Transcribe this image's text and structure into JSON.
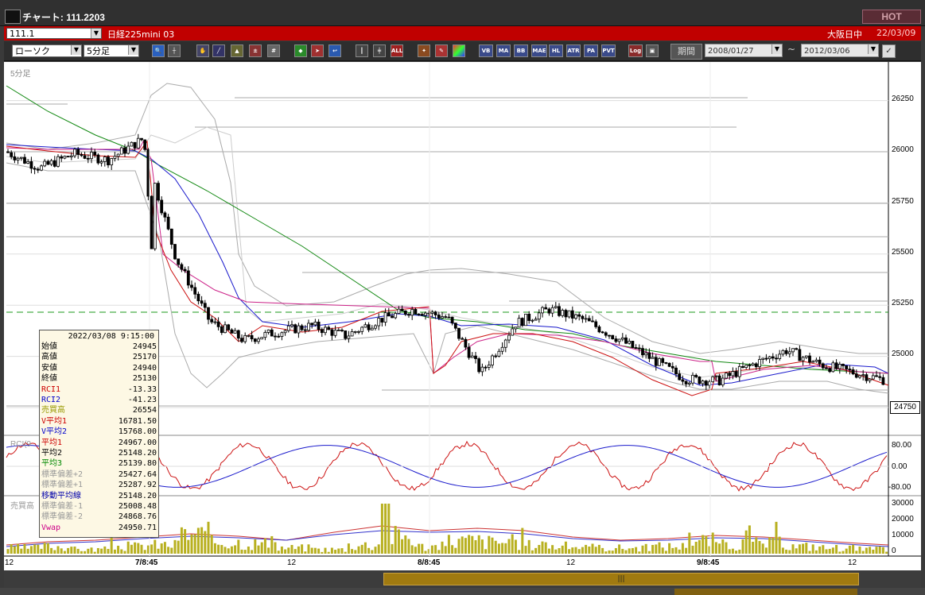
{
  "window": {
    "title": "チャート: 111.2203",
    "hot_label": "HOT"
  },
  "header": {
    "symbol": "111.1",
    "instrument": "日経225mini 03",
    "market": "大阪日中",
    "date": "22/03/09"
  },
  "toolbar": {
    "chart_type": "ローソク",
    "interval": "5分足",
    "icons": [
      "zoom-icon",
      "cursor-icon",
      "hand-icon",
      "line-icon",
      "shape-icon",
      "measure-icon",
      "grid-icon",
      "fill-icon",
      "pointer-icon",
      "arrow-icon",
      "candle-icon",
      "bar-icon",
      "all-icon",
      "wrench-icon",
      "palette-icon",
      "color-icon"
    ],
    "indicator_buttons": [
      "VB",
      "MA",
      "BB",
      "MAE",
      "HL",
      "ATR",
      "PA RA",
      "PVT",
      "Log"
    ],
    "period_label": "期間",
    "date_from": "2008/01/27",
    "date_sep": "~",
    "date_to": "2012/03/06"
  },
  "chart": {
    "panel_label": "5分足",
    "rci_label": "RCI(9",
    "volume_label": "売買高",
    "current_price_label": "24750",
    "price_ticks": [
      "26250",
      "26000",
      "25750",
      "25500",
      "25250",
      "25000"
    ],
    "rci_ticks": [
      "80.00",
      "0.00",
      "-80.00"
    ],
    "volume_ticks": [
      "30000",
      "20000",
      "10000",
      "0"
    ],
    "x_ticks": [
      "12",
      "7/8:45",
      "12",
      "8/8:45",
      "12",
      "9/8:45",
      "12"
    ]
  },
  "chart_data": {
    "type": "candlestick",
    "series": [
      {
        "name": "price_close_approx",
        "values": [
          26000,
          25920,
          25990,
          25960,
          26060,
          25480,
          25170,
          25080,
          25120,
          25150,
          25100,
          25180,
          25230,
          25190,
          24920,
          25160,
          25230,
          25180,
          25090,
          24990,
          24890,
          24880,
          24960,
          25030,
          24960,
          24920,
          24880
        ]
      },
      {
        "name": "volume_approx",
        "values": [
          4000,
          5000,
          3000,
          5000,
          6000,
          13000,
          8000,
          7000,
          4000,
          3000,
          6000,
          12000,
          5000,
          9000,
          8000,
          6000,
          5000,
          4000,
          4000,
          5000,
          9000,
          6000,
          7000,
          5000,
          4000,
          3000,
          2000
        ]
      }
    ],
    "y_ticks": [
      26250,
      26000,
      25750,
      25500,
      25250,
      25000
    ],
    "current_price": 24750,
    "rci_range": [
      -100,
      100
    ],
    "volume_ticks": [
      30000,
      20000,
      10000,
      0
    ]
  },
  "info": {
    "datetime": "2022/03/08 9:15:00",
    "rows": [
      {
        "label": "始値",
        "value": "24945",
        "color": "#000000"
      },
      {
        "label": "高値",
        "value": "25170",
        "color": "#000000"
      },
      {
        "label": "安値",
        "value": "24940",
        "color": "#000000"
      },
      {
        "label": "終値",
        "value": "25130",
        "color": "#000000"
      },
      {
        "label": "RCI1",
        "value": "-13.33",
        "color": "#cc0000"
      },
      {
        "label": "RCI2",
        "value": "-41.23",
        "color": "#0000cc"
      },
      {
        "label": "売買高",
        "value": "26554",
        "color": "#999900"
      },
      {
        "label": "V平均1",
        "value": "16781.50",
        "color": "#cc0000"
      },
      {
        "label": "V平均2",
        "value": "15768.00",
        "color": "#0000cc"
      },
      {
        "label": "平均1",
        "value": "24967.00",
        "color": "#cc0000"
      },
      {
        "label": "平均2",
        "value": "25148.20",
        "color": "#000000"
      },
      {
        "label": "平均3",
        "value": "25139.80",
        "color": "#008800"
      },
      {
        "label": "標準偏差+2",
        "value": "25427.64",
        "color": "#999999"
      },
      {
        "label": "標準偏差+1",
        "value": "25287.92",
        "color": "#999999"
      },
      {
        "label": "移動平均線",
        "value": "25148.20",
        "color": "#0000aa"
      },
      {
        "label": "標準偏差-1",
        "value": "25008.48",
        "color": "#999999"
      },
      {
        "label": "標準偏差-2",
        "value": "24868.76",
        "color": "#999999"
      },
      {
        "label": "Vwap",
        "value": "24950.71",
        "color": "#cc0088"
      }
    ]
  }
}
